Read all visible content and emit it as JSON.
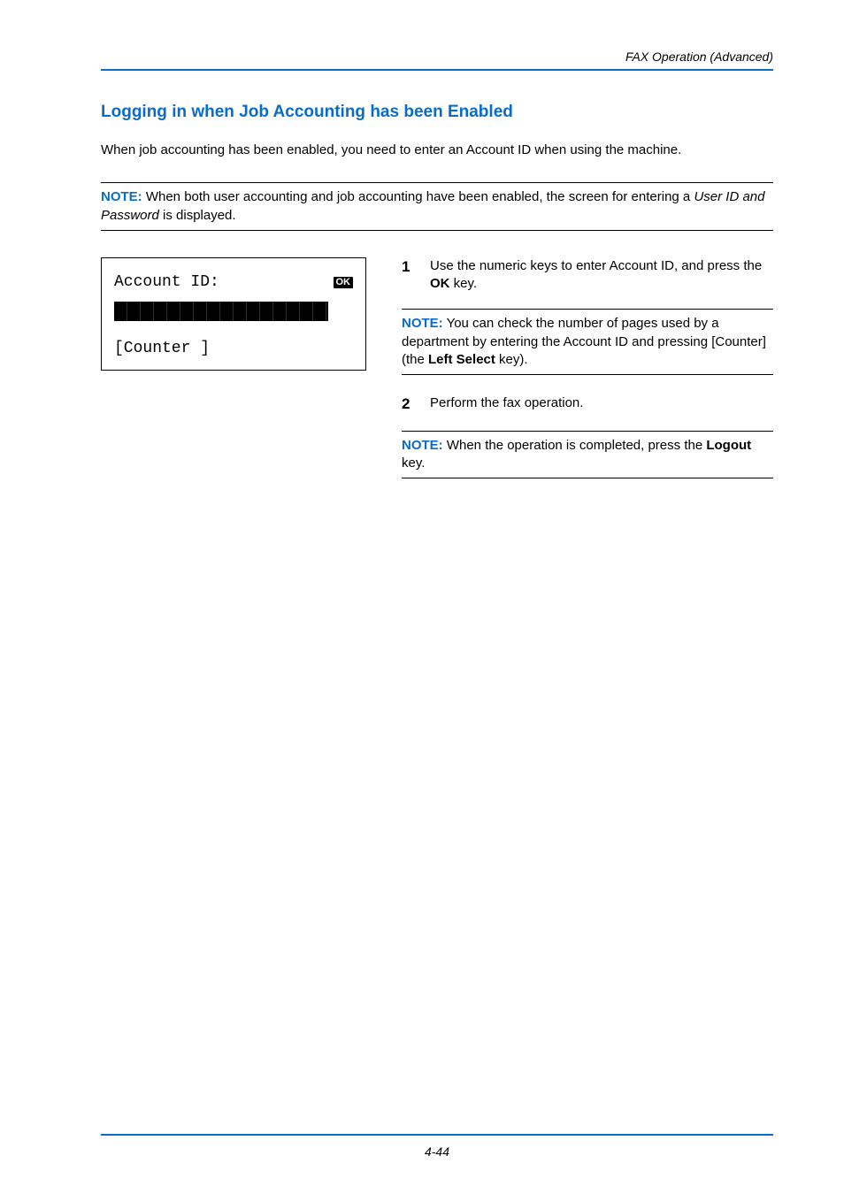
{
  "header": {
    "running": "FAX Operation (Advanced)"
  },
  "section": {
    "title": "Logging in when Job Accounting has been Enabled"
  },
  "intro": "When job accounting has been enabled, you need to enter an Account ID when using the machine.",
  "note1": {
    "label": "NOTE:",
    "before": " When both user accounting and job accounting have been enabled, the screen for entering a ",
    "italic": "User ID and Password",
    "after": " is displayed."
  },
  "lcd": {
    "line1": "Account ID:",
    "ok": "OK",
    "line3": "[Counter ]"
  },
  "step1": {
    "num": "1",
    "before": "Use the numeric keys to enter Account ID, and press the ",
    "bold": "OK",
    "after": " key."
  },
  "note2": {
    "label": "NOTE:",
    "a": " You can check the number of pages used by a department by entering the Account ID and pressing [Counter] (the ",
    "bold": "Left Select",
    "b": " key)."
  },
  "step2": {
    "num": "2",
    "text": "Perform the fax operation."
  },
  "note3": {
    "label": "NOTE:",
    "a": " When the operation is completed, press the ",
    "bold": "Logout",
    "b": " key."
  },
  "footer": {
    "page": "4-44"
  }
}
